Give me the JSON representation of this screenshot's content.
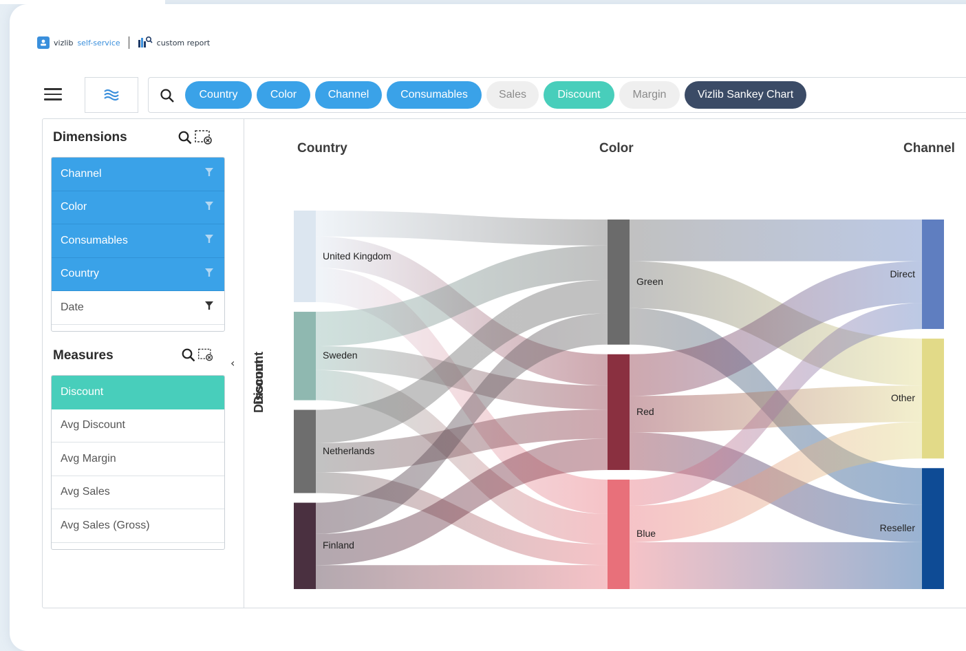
{
  "breadcrumb": {
    "brand_prefix": "vizlib",
    "brand_suffix": "self-service",
    "report": "custom report"
  },
  "toolbar": {
    "pills": [
      {
        "label": "Country",
        "color": "#3aa2e8",
        "text_color": "#ffffff"
      },
      {
        "label": "Color",
        "color": "#3aa2e8",
        "text_color": "#ffffff"
      },
      {
        "label": "Channel",
        "color": "#3aa2e8",
        "text_color": "#ffffff"
      },
      {
        "label": "Consumables",
        "color": "#3aa2e8",
        "text_color": "#ffffff"
      },
      {
        "label": "Sales",
        "color": "#efefef",
        "text_color": "#8a8a8a"
      },
      {
        "label": "Discount",
        "color": "#48cebb",
        "text_color": "#ffffff"
      },
      {
        "label": "Margin",
        "color": "#efefef",
        "text_color": "#8a8a8a"
      },
      {
        "label": "Vizlib Sankey Chart",
        "color": "#3b4b66",
        "text_color": "#ffffff"
      }
    ]
  },
  "dimensions": {
    "title": "Dimensions",
    "items": [
      {
        "label": "Channel",
        "selected": true
      },
      {
        "label": "Color",
        "selected": true
      },
      {
        "label": "Consumables",
        "selected": true
      },
      {
        "label": "Country",
        "selected": true
      },
      {
        "label": "Date",
        "selected": false
      }
    ]
  },
  "measures": {
    "title": "Measures",
    "items": [
      {
        "label": "Discount",
        "selected": true
      },
      {
        "label": "Avg Discount",
        "selected": false
      },
      {
        "label": "Avg Margin",
        "selected": false
      },
      {
        "label": "Avg Sales",
        "selected": false
      },
      {
        "label": "Avg Sales (Gross)",
        "selected": false
      }
    ]
  },
  "chart_data": {
    "type": "sankey",
    "measure_label": "Discount",
    "columns": [
      "Country",
      "Color",
      "Channel"
    ],
    "nodes": {
      "Country": [
        {
          "name": "United Kingdom",
          "color": "#dce6f0"
        },
        {
          "name": "Sweden",
          "color": "#8fb8b0"
        },
        {
          "name": "Netherlands",
          "color": "#6e6e6e"
        },
        {
          "name": "Finland",
          "color": "#4a3040"
        }
      ],
      "Color": [
        {
          "name": "Green",
          "color": "#6b6b6b"
        },
        {
          "name": "Red",
          "color": "#8a3040"
        },
        {
          "name": "Blue",
          "color": "#e8707a"
        }
      ],
      "Channel": [
        {
          "name": "Direct",
          "color": "#5f7ec0"
        },
        {
          "name": "Other",
          "color": "#e2da88"
        },
        {
          "name": "Reseller",
          "color": "#0e4b95"
        }
      ]
    },
    "links": [
      {
        "source": "United Kingdom",
        "target": "Green",
        "value": 25
      },
      {
        "source": "United Kingdom",
        "target": "Red",
        "value": 30
      },
      {
        "source": "United Kingdom",
        "target": "Blue",
        "value": 33
      },
      {
        "source": "Sweden",
        "target": "Green",
        "value": 33
      },
      {
        "source": "Sweden",
        "target": "Red",
        "value": 23
      },
      {
        "source": "Sweden",
        "target": "Blue",
        "value": 29
      },
      {
        "source": "Netherlands",
        "target": "Green",
        "value": 32
      },
      {
        "source": "Netherlands",
        "target": "Red",
        "value": 28
      },
      {
        "source": "Netherlands",
        "target": "Blue",
        "value": 20
      },
      {
        "source": "Finland",
        "target": "Green",
        "value": 30
      },
      {
        "source": "Finland",
        "target": "Red",
        "value": 30
      },
      {
        "source": "Finland",
        "target": "Blue",
        "value": 23
      },
      {
        "source": "Green",
        "target": "Direct",
        "value": 40
      },
      {
        "source": "Green",
        "target": "Other",
        "value": 45
      },
      {
        "source": "Green",
        "target": "Reseller",
        "value": 35
      },
      {
        "source": "Red",
        "target": "Direct",
        "value": 40
      },
      {
        "source": "Red",
        "target": "Other",
        "value": 35
      },
      {
        "source": "Red",
        "target": "Reseller",
        "value": 36
      },
      {
        "source": "Blue",
        "target": "Direct",
        "value": 25
      },
      {
        "source": "Blue",
        "target": "Other",
        "value": 35
      },
      {
        "source": "Blue",
        "target": "Reseller",
        "value": 45
      }
    ]
  }
}
